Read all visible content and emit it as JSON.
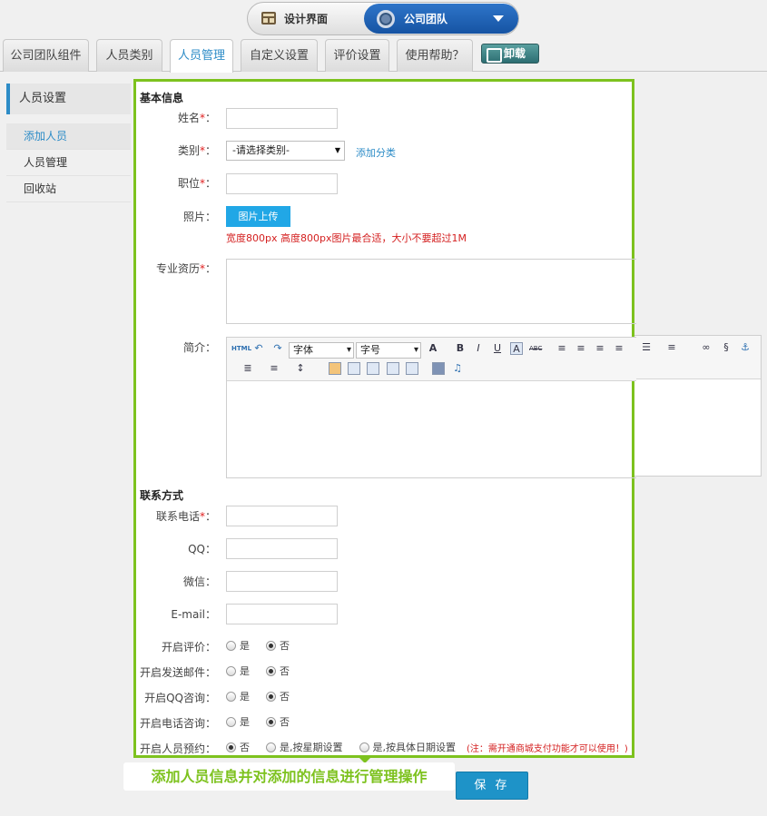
{
  "switcher": {
    "design_label": "设计界面",
    "team_label": "公司团队"
  },
  "tabs": [
    {
      "label": "公司团队组件"
    },
    {
      "label": "人员类别"
    },
    {
      "label": "人员管理"
    },
    {
      "label": "自定义设置"
    },
    {
      "label": "评价设置"
    },
    {
      "label": "使用帮助？"
    }
  ],
  "uninstall_label": "卸载",
  "sidebar": {
    "head": "人员设置",
    "items": [
      {
        "label": "添加人员"
      },
      {
        "label": "人员管理"
      },
      {
        "label": "回收站"
      }
    ]
  },
  "form": {
    "section_basic": "基本信息",
    "name_label": "姓名",
    "category_label": "类别",
    "category_value": "-请选择类别-",
    "add_category_link": "添加分类",
    "position_label": "职位",
    "photo_label": "照片",
    "upload_button": "图片上传",
    "photo_hint": "宽度800px 高度800px图片最合适，大小不要超过1M",
    "qualification_label": "专业资历",
    "intro_label": "简介",
    "editor": {
      "html_btn": "HTML",
      "font_value": "字体",
      "size_value": "字号"
    },
    "section_contact": "联系方式",
    "phone_label": "联系电话",
    "qq_label": "QQ",
    "wechat_label": "微信",
    "email_label": "E-mail",
    "colon": "：",
    "req": "*",
    "yes": "是",
    "no": "否",
    "review_label": "开启评价",
    "mail_label": "开启发送邮件",
    "qq_consult_label": "开启QQ咨询",
    "phone_consult_label": "开启电话咨询",
    "booking_label": "开启人员预约",
    "booking_week": "是,按星期设置",
    "booking_date": "是,按具体日期设置",
    "booking_note": "(注：需开通商城支付功能才可以使用！)"
  },
  "callout": "添加人员信息并对添加的信息进行管理操作",
  "save_label": "保 存",
  "colors": {
    "accent": "#2d8cc7",
    "highlight": "#7dc21e",
    "required": "#e02020"
  }
}
